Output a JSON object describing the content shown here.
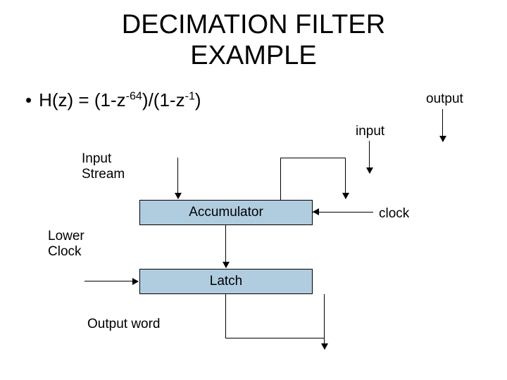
{
  "title_line1": "DECIMATION FILTER",
  "title_line2": "EXAMPLE",
  "equation": {
    "prefix": "H(z) = (1-z",
    "exp1": "-64",
    "mid": ")/(1-z",
    "exp2": "-1",
    "suffix": ")"
  },
  "labels": {
    "output": "output",
    "input": "input",
    "input_stream_l1": "Input",
    "input_stream_l2": "Stream",
    "clock": "clock",
    "lower_clock_l1": "Lower",
    "lower_clock_l2": "Clock",
    "output_word": "Output word"
  },
  "boxes": {
    "accumulator": "Accumulator",
    "latch": "Latch"
  }
}
